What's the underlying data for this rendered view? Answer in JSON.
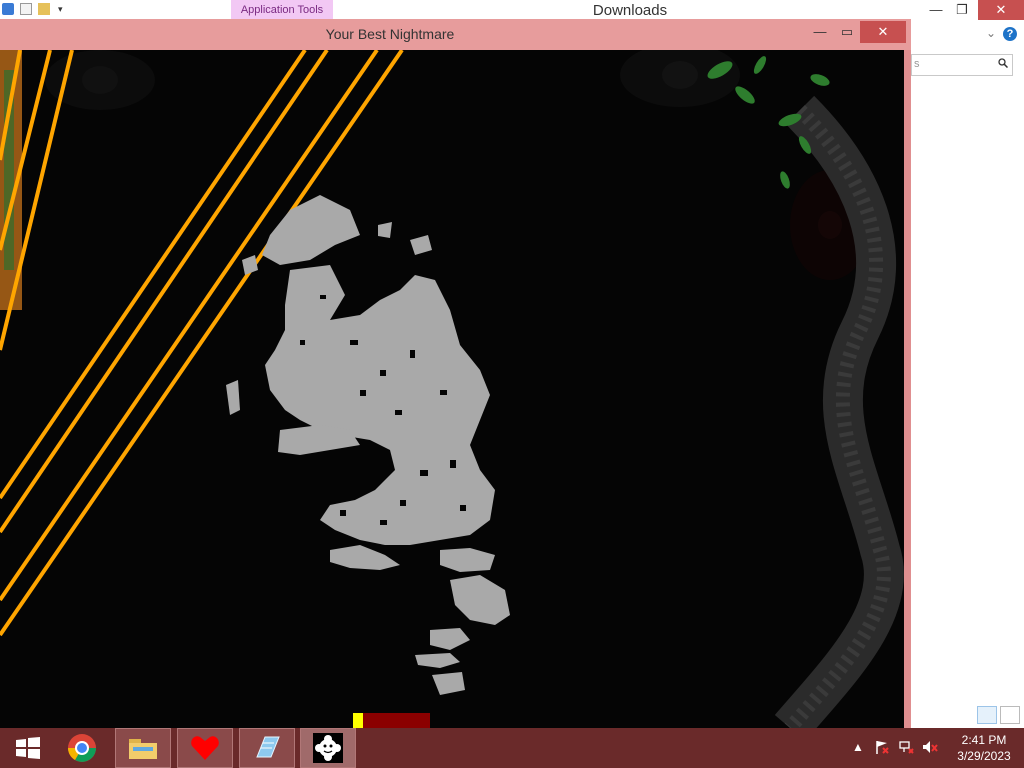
{
  "explorer": {
    "title": "Downloads",
    "context_tab": "Application Tools",
    "search_hint": "s",
    "minimize_glyph": "—",
    "restore_glyph": "❐",
    "close_glyph": "✕",
    "help_glyph": "?",
    "chevron_glyph": "⌄"
  },
  "game_window": {
    "title": "Your Best Nightmare",
    "minimize_glyph": "—",
    "maximize_glyph": "▭",
    "close_glyph": "✕"
  },
  "taskbar": {
    "apps": [
      {
        "name": "start",
        "label": "Start"
      },
      {
        "name": "chrome",
        "label": "Google Chrome"
      },
      {
        "name": "file-explorer",
        "label": "File Explorer"
      },
      {
        "name": "undertale",
        "label": "Undertale heart"
      },
      {
        "name": "notepad",
        "label": "Notepad"
      },
      {
        "name": "your-best-nightmare",
        "label": "Your Best Nightmare"
      }
    ],
    "time": "2:41 PM",
    "date": "3/29/2023",
    "tray_show_glyph": "▲"
  },
  "colors": {
    "game_titlebar": "#e79c9c",
    "taskbar": "#6a2a2a",
    "laser": "#ffa500",
    "creature": "#a9a9a9",
    "hp_bar": "#8b0000",
    "hp_fill": "#ffff00"
  }
}
